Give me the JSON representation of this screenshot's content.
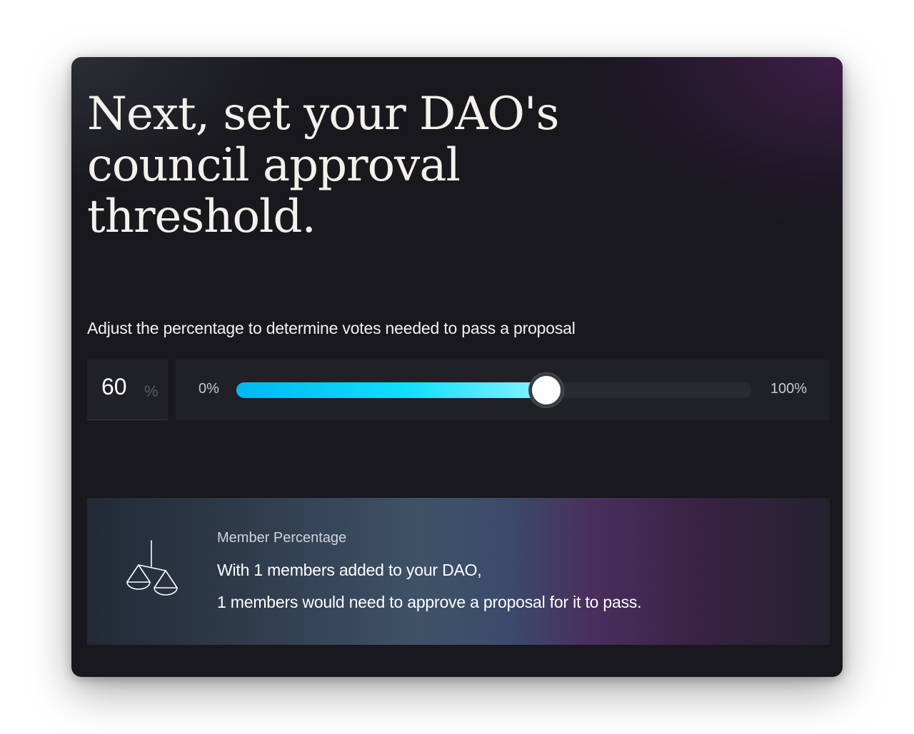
{
  "page": {
    "heading": "Next, set your DAO's council approval threshold.",
    "subtitle": "Adjust the percentage to determine votes needed to pass a proposal"
  },
  "threshold": {
    "value": "60",
    "unit": "%",
    "slider_min_label": "0%",
    "slider_max_label": "100%",
    "slider_value_percent": 60,
    "fill_color_start": "#00b8f0",
    "fill_color_end": "#8af2ff"
  },
  "info_card": {
    "icon": "scale-icon",
    "label": "Member Percentage",
    "line1": "With 1 members added to your DAO,",
    "line2": "1 members would need to approve a proposal for it to pass."
  }
}
